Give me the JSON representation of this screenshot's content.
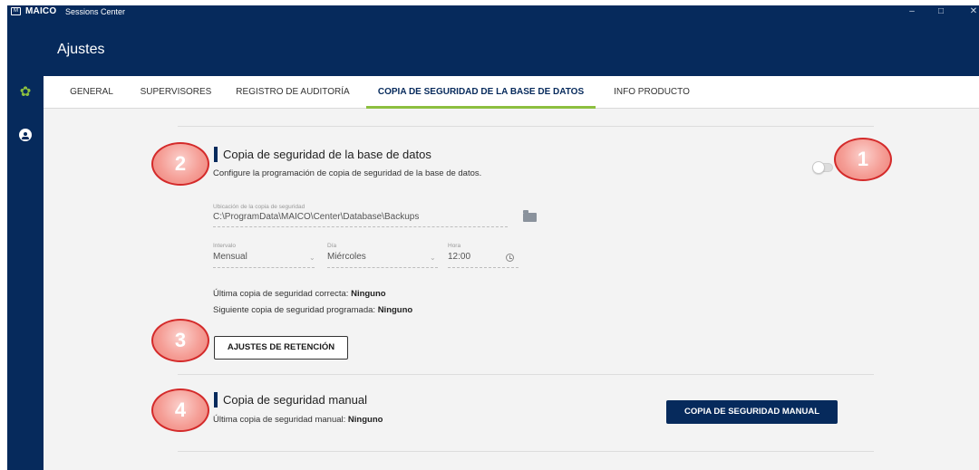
{
  "titlebar": {
    "logo": "M",
    "brand": "MAICO",
    "app_name": "Sessions Center",
    "minimize": "–",
    "maximize": "□",
    "close": "✕"
  },
  "header": {
    "title": "Ajustes"
  },
  "sidebar": {
    "items": [
      {
        "icon": "gear-icon"
      },
      {
        "icon": "user-icon"
      }
    ]
  },
  "tabs": [
    {
      "label": "GENERAL"
    },
    {
      "label": "SUPERVISORES"
    },
    {
      "label": "REGISTRO DE AUDITORÍA"
    },
    {
      "label": "COPIA DE SEGURIDAD DE LA BASE DE DATOS",
      "active": true
    },
    {
      "label": "INFO PRODUCTO"
    }
  ],
  "backup": {
    "title": "Copia de seguridad de la base de datos",
    "description": "Configure la programación de copia de seguridad de la base de datos.",
    "enabled": false,
    "location": {
      "label": "Ubicación de la copia de seguridad",
      "value": "C:\\ProgramData\\MAICO\\Center\\Database\\Backups"
    },
    "interval": {
      "label": "Intervalo",
      "value": "Mensual"
    },
    "day": {
      "label": "Día",
      "value": "Miércoles"
    },
    "time": {
      "label": "Hora",
      "value": "12:00"
    },
    "last_label": "Última copia de seguridad correcta:",
    "last_value": "Ninguno",
    "next_label": "Siguiente copia de seguridad programada:",
    "next_value": "Ninguno",
    "retention_button": "AJUSTES DE RETENCIÓN"
  },
  "manual": {
    "title": "Copia de seguridad manual",
    "last_label": "Última copia de seguridad manual:",
    "last_value": "Ninguno",
    "button": "COPIA DE SEGURIDAD MANUAL"
  },
  "callouts": [
    "1",
    "2",
    "3",
    "4"
  ],
  "colors": {
    "navy": "#062a5c",
    "accent_green": "#8cbf3f",
    "callout_fill": "#f59e96",
    "callout_border": "#d42a2a"
  }
}
